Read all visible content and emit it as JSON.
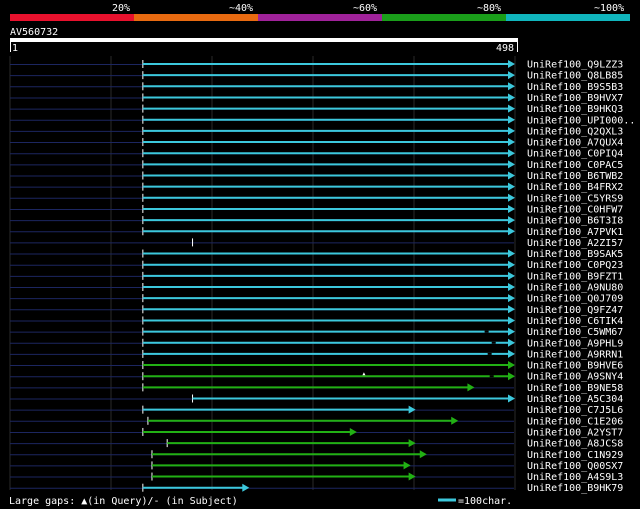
{
  "colors": {
    "scale": [
      "#e8112d",
      "#e86a10",
      "#a0229a",
      "#1a9e1a",
      "#10b5bd"
    ],
    "cyan": "#3cc8dc",
    "green": "#22b014",
    "query_line": "#1c2660",
    "grid": "#2a2a2a"
  },
  "identity_scale": {
    "labels": [
      "20%",
      "~40%",
      "~60%",
      "~80%",
      "~100%"
    ],
    "level_fractions": [
      0.2,
      0.4,
      0.6,
      0.8,
      1.0
    ]
  },
  "query": {
    "name": "AV560732",
    "start": "1",
    "end": "498",
    "length": 498
  },
  "hits": [
    {
      "name": "UniRef100_Q9LZZ3",
      "start": 132,
      "end": 498,
      "color": "cyan",
      "gaps": []
    },
    {
      "name": "UniRef100_Q8LB85",
      "start": 132,
      "end": 498,
      "color": "cyan",
      "gaps": []
    },
    {
      "name": "UniRef100_B9S5B3",
      "start": 132,
      "end": 498,
      "color": "cyan",
      "gaps": []
    },
    {
      "name": "UniRef100_B9HVX7",
      "start": 132,
      "end": 498,
      "color": "cyan",
      "gaps": []
    },
    {
      "name": "UniRef100_B9HKQ3",
      "start": 132,
      "end": 498,
      "color": "cyan",
      "gaps": []
    },
    {
      "name": "UniRef100_UPI000..",
      "start": 132,
      "end": 498,
      "color": "cyan",
      "gaps": []
    },
    {
      "name": "UniRef100_Q2QXL3",
      "start": 132,
      "end": 498,
      "color": "cyan",
      "gaps": []
    },
    {
      "name": "UniRef100_A7QUX4",
      "start": 132,
      "end": 498,
      "color": "cyan",
      "gaps": []
    },
    {
      "name": "UniRef100_C0PIQ4",
      "start": 132,
      "end": 498,
      "color": "cyan",
      "gaps": []
    },
    {
      "name": "UniRef100_C0PAC5",
      "start": 132,
      "end": 498,
      "color": "cyan",
      "gaps": []
    },
    {
      "name": "UniRef100_B6TWB2",
      "start": 132,
      "end": 498,
      "color": "cyan",
      "gaps": []
    },
    {
      "name": "UniRef100_B4FRX2",
      "start": 132,
      "end": 498,
      "color": "cyan",
      "gaps": []
    },
    {
      "name": "UniRef100_C5YRS9",
      "start": 132,
      "end": 498,
      "color": "cyan",
      "gaps": []
    },
    {
      "name": "UniRef100_C0HFW7",
      "start": 132,
      "end": 498,
      "color": "cyan",
      "gaps": []
    },
    {
      "name": "UniRef100_B6T3I8",
      "start": 132,
      "end": 498,
      "color": "cyan",
      "gaps": []
    },
    {
      "name": "UniRef100_A7PVK1",
      "start": 132,
      "end": 498,
      "color": "cyan",
      "gaps": []
    },
    {
      "name": "UniRef100_A2ZI57",
      "start": 181,
      "end": 181,
      "color": "cyan",
      "gaps": []
    },
    {
      "name": "UniRef100_B9SAK5",
      "start": 132,
      "end": 498,
      "color": "cyan",
      "gaps": []
    },
    {
      "name": "UniRef100_C0PQ23",
      "start": 132,
      "end": 498,
      "color": "cyan",
      "gaps": []
    },
    {
      "name": "UniRef100_B9FZT1",
      "start": 132,
      "end": 498,
      "color": "cyan",
      "gaps": []
    },
    {
      "name": "UniRef100_A9NU80",
      "start": 132,
      "end": 498,
      "color": "cyan",
      "gaps": []
    },
    {
      "name": "UniRef100_Q0J709",
      "start": 132,
      "end": 498,
      "color": "cyan",
      "gaps": []
    },
    {
      "name": "UniRef100_Q9FZ47",
      "start": 132,
      "end": 498,
      "color": "cyan",
      "gaps": []
    },
    {
      "name": "UniRef100_C6TIK4",
      "start": 132,
      "end": 498,
      "color": "cyan",
      "gaps": []
    },
    {
      "name": "UniRef100_C5WM67",
      "start": 132,
      "end": 498,
      "color": "cyan",
      "gaps": [],
      "subject_gaps": [
        471
      ]
    },
    {
      "name": "UniRef100_A9PHL9",
      "start": 132,
      "end": 498,
      "color": "cyan",
      "gaps": [],
      "subject_gaps": [
        478
      ]
    },
    {
      "name": "UniRef100_A9RRN1",
      "start": 132,
      "end": 498,
      "color": "cyan",
      "gaps": [],
      "subject_gaps": [
        474
      ]
    },
    {
      "name": "UniRef100_B9HVE6",
      "start": 132,
      "end": 498,
      "color": "green",
      "gaps": []
    },
    {
      "name": "UniRef100_A9SNY4",
      "start": 132,
      "end": 498,
      "color": "green",
      "gaps": [
        350
      ],
      "subject_gaps": [
        476
      ]
    },
    {
      "name": "UniRef100_B9NE58",
      "start": 132,
      "end": 458,
      "color": "green",
      "gaps": []
    },
    {
      "name": "UniRef100_A5C304",
      "start": 181,
      "end": 498,
      "color": "cyan",
      "gaps": []
    },
    {
      "name": "UniRef100_C7J5L6",
      "start": 132,
      "end": 400,
      "color": "cyan",
      "gaps": []
    },
    {
      "name": "UniRef100_C1E206",
      "start": 137,
      "end": 442,
      "color": "green",
      "gaps": []
    },
    {
      "name": "UniRef100_A2YST7",
      "start": 132,
      "end": 342,
      "color": "green",
      "gaps": []
    },
    {
      "name": "UniRef100_A8JCS8",
      "start": 156,
      "end": 400,
      "color": "green",
      "gaps": []
    },
    {
      "name": "UniRef100_C1N929",
      "start": 141,
      "end": 411,
      "color": "green",
      "gaps": []
    },
    {
      "name": "UniRef100_Q00SX7",
      "start": 141,
      "end": 395,
      "color": "green",
      "gaps": []
    },
    {
      "name": "UniRef100_A4S9L3",
      "start": 141,
      "end": 400,
      "color": "green",
      "gaps": []
    },
    {
      "name": "UniRef100_B9HK79",
      "start": 132,
      "end": 236,
      "color": "cyan",
      "gaps": []
    }
  ],
  "legend": {
    "large_gaps_text": "Large gaps: ▲(in Query)/- (in Subject)",
    "scale_text": "=100char."
  }
}
